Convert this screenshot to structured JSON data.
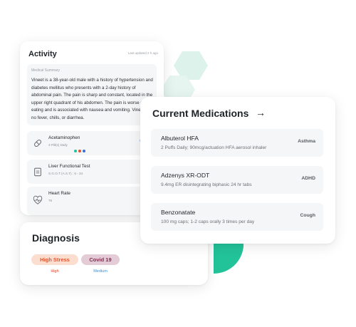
{
  "colors": {
    "accent_teal": "#23c39a",
    "accent_light": "#dcf2ea",
    "high_stress_bg": "#fcded0",
    "high_stress_text": "#e0562e",
    "covid_bg": "#e3ccd6",
    "covid_text": "#7d2f4f",
    "high_label": "#d9442b",
    "medium_label": "#3a8fd6"
  },
  "activity": {
    "title": "Activity",
    "updated": "Last updated 2 h ago",
    "summary_label": "Medical Summary",
    "summary_text": "Vineet is a 38-year-old male with a history of hypertension and diabetes mellitus who presents with a 2-day history of abdominal pain. The pain is sharp and constant, located in the upper right quadrant of his abdomen. The pain is worse after eating and is associated with nausea and vomiting. Vineet has no fever, chills, or diarrhea.",
    "items": [
      {
        "name": "Acetaminophen",
        "sub": "3 Pill(s) Daily",
        "link": "Send re",
        "icon": "pill-icon",
        "dots": [
          "#23c39a",
          "#e0562e",
          "#3d6fd1"
        ]
      },
      {
        "name": "Liver Functional Test",
        "sub": "S.G.O.T (A.S.T) : 6 - 34",
        "link": "View",
        "icon": "clipboard-icon"
      },
      {
        "name": "Heart Rate",
        "sub": "76",
        "icon": "heart-pulse-icon"
      }
    ]
  },
  "diagnosis": {
    "title": "Diagnosis",
    "tags": [
      {
        "label": "High Stress",
        "level": "High"
      },
      {
        "label": "Covid 19",
        "level": "Medium"
      }
    ]
  },
  "medications": {
    "title": "Current Medications",
    "arrow": "→",
    "items": [
      {
        "name": "Albuterol HFA",
        "dose": "2 Puffs Daily; 90mcg/actuation HFA aerosol inhaler",
        "condition": "Asthma"
      },
      {
        "name": "Adzenys XR-ODT",
        "dose": "9.4mg ER disintegrating biphasic 24 hr tabs",
        "condition": "ADHD"
      },
      {
        "name": "Benzonatate",
        "dose": "100 mg caps; 1-2 caps orally 3 times per day",
        "condition": "Cough"
      }
    ]
  }
}
